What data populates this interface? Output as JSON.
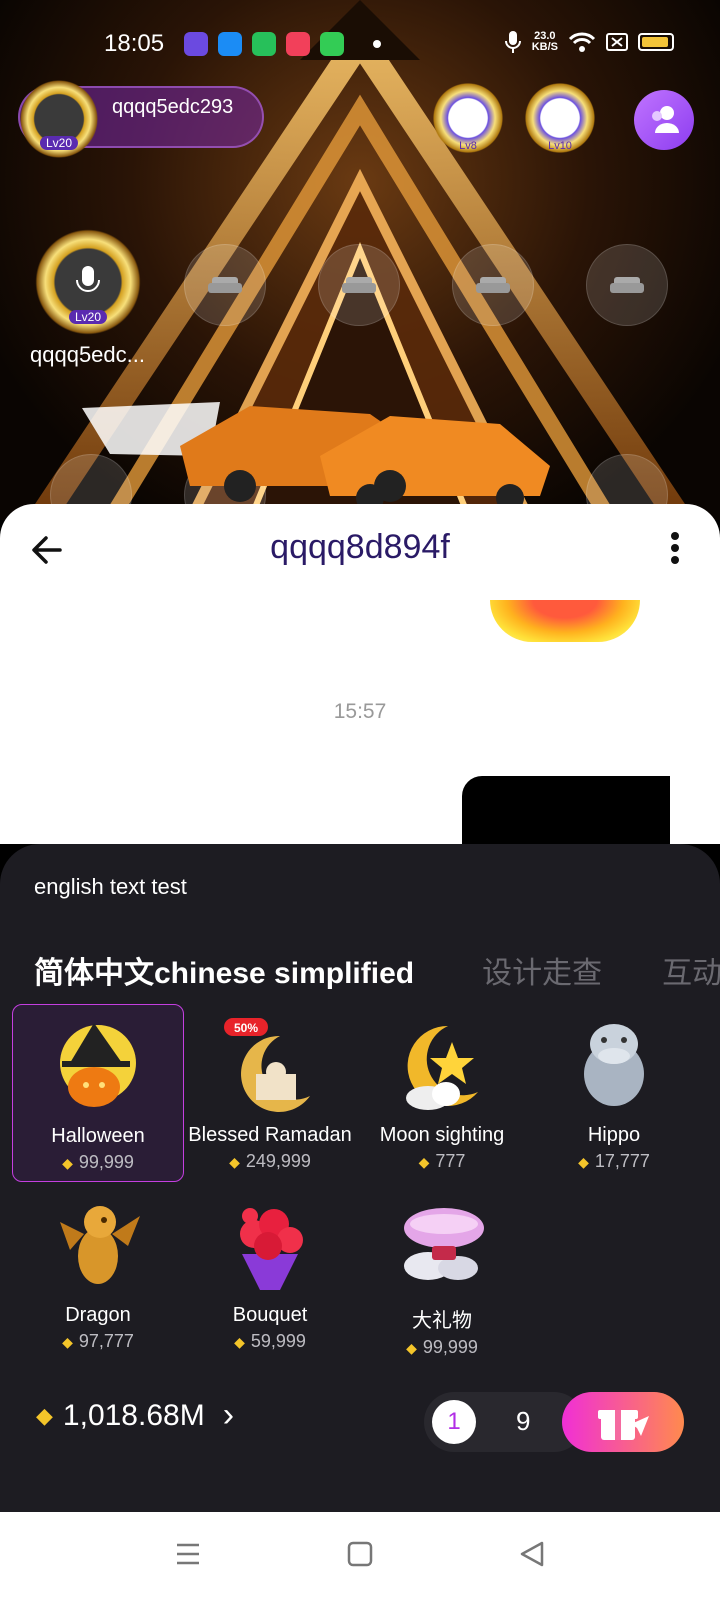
{
  "status_bar": {
    "time": "18:05",
    "net_speed": "23.0",
    "net_unit": "KB/S"
  },
  "room": {
    "host": {
      "name": "qqqq5edc293",
      "level": "Lv20"
    },
    "top_badges": [
      {
        "level": "Lv8"
      },
      {
        "level": "Lv10"
      }
    ],
    "seats": {
      "occupied_name": "qqqq5edc...",
      "occupied_level": "Lv20"
    }
  },
  "chat": {
    "title": "qqqq8d894f",
    "timestamp": "15:57"
  },
  "gift_panel": {
    "notice": "english text test",
    "tabs": [
      "简体中文chinese simplified",
      "设计走查",
      "互动"
    ],
    "gifts": [
      {
        "name": "Halloween",
        "price": "99,999",
        "selected": true
      },
      {
        "name": "Blessed Ramadan",
        "price": "249,999",
        "tag": "50%"
      },
      {
        "name": "Moon sighting",
        "price": "777"
      },
      {
        "name": "Hippo",
        "price": "17,777"
      },
      {
        "name": "Dragon",
        "price": "97,777"
      },
      {
        "name": "Bouquet",
        "price": "59,999"
      },
      {
        "name": "大礼物",
        "price": "99,999"
      }
    ],
    "balance": "1,018.68M",
    "quantity_selected": "1",
    "quantity_option": "9"
  },
  "colors": {
    "accent": "#c43fe0",
    "diamond": "#f4c52a",
    "panel_bg": "#1d1c22",
    "title": "#2a1a66"
  }
}
